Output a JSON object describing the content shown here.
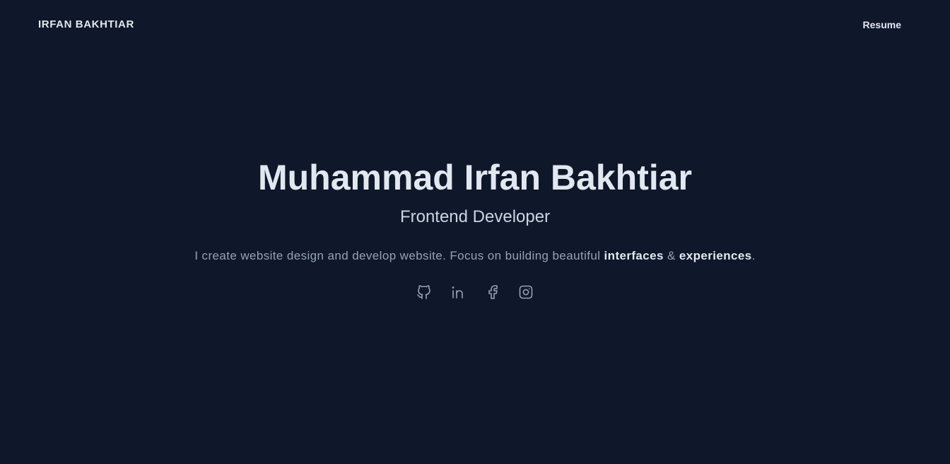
{
  "nav": {
    "brand": "IRFAN BAKHTIAR",
    "resume_label": "Resume"
  },
  "hero": {
    "name": "Muhammad Irfan Bakhtiar",
    "role": "Frontend Developer",
    "tagline_prefix": "I create website design and develop website. Focus on building beautiful ",
    "tagline_highlight_1": "interfaces",
    "tagline_joiner": " & ",
    "tagline_highlight_2": "experiences",
    "tagline_suffix": "."
  },
  "socials": [
    {
      "icon": "github-icon"
    },
    {
      "icon": "linkedin-icon"
    },
    {
      "icon": "facebook-icon"
    },
    {
      "icon": "instagram-icon"
    }
  ],
  "colors": {
    "background": "#0f172a",
    "text_primary": "#e2e8f0",
    "text_muted": "#94a3b8"
  }
}
